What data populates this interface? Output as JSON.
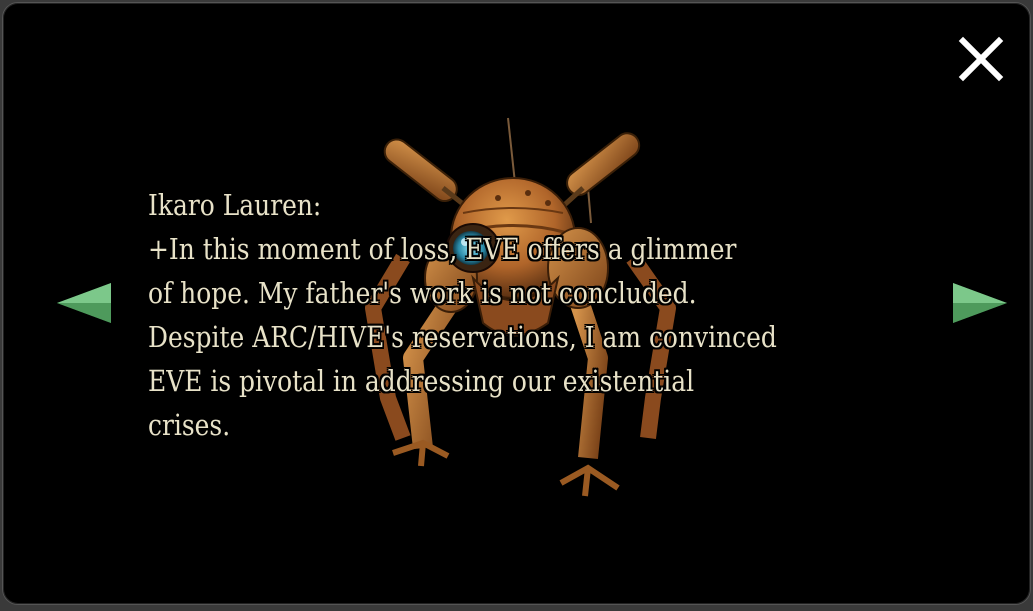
{
  "dialog": {
    "speaker": "Ikaro Lauren:",
    "lines": [
      "+In this moment of loss, EVE offers a glimmer",
      "of hope. My father's work is not concluded.",
      "Despite ARC/HIVE's reservations, I am convinced",
      "EVE is pivotal in addressing our existential",
      "crises."
    ]
  },
  "icons": {
    "close": "close-icon",
    "previous": "arrow-left-icon",
    "next": "arrow-right-icon",
    "portrait": "robot-drone-portrait"
  },
  "colors": {
    "text": "#e8e2c8",
    "arrow": "#5aa86a",
    "background": "#000000"
  }
}
